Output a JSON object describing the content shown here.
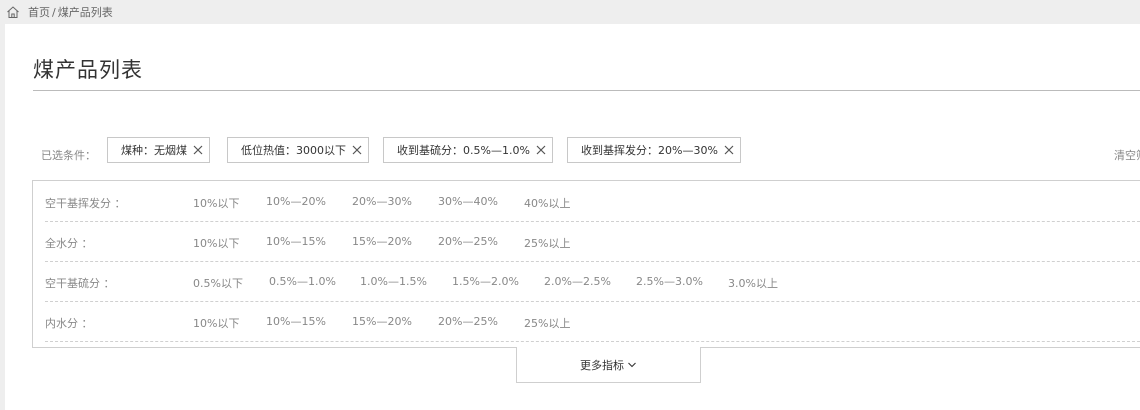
{
  "breadcrumb": {
    "home": "首页",
    "separator": "/",
    "current": "煤产品列表"
  },
  "page_title": "煤产品列表",
  "selected": {
    "label": "已选条件：",
    "tags": [
      {
        "label": "煤种：无烟煤"
      },
      {
        "label": "低位热值：3000以下"
      },
      {
        "label": "收到基硫分：0.5%—1.0%"
      },
      {
        "label": "收到基挥发分：20%—30%"
      }
    ],
    "clear_label": "清空筛"
  },
  "filters": [
    {
      "label": "空干基挥发分 ：",
      "options": [
        "10%以下",
        "10%—20%",
        "20%—30%",
        "30%—40%",
        "40%以上"
      ]
    },
    {
      "label": "全水分 ：",
      "options": [
        "10%以下",
        "10%—15%",
        "15%—20%",
        "20%—25%",
        "25%以上"
      ]
    },
    {
      "label": "空干基硫分 ：",
      "options": [
        "0.5%以下",
        "0.5%—1.0%",
        "1.0%—1.5%",
        "1.5%—2.0%",
        "2.0%—2.5%",
        "2.5%—3.0%",
        "3.0%以上"
      ]
    },
    {
      "label": "内水分 ：",
      "options": [
        "10%以下",
        "10%—15%",
        "15%—20%",
        "20%—25%",
        "25%以上"
      ]
    }
  ],
  "more_button": {
    "label": "更多指标"
  }
}
